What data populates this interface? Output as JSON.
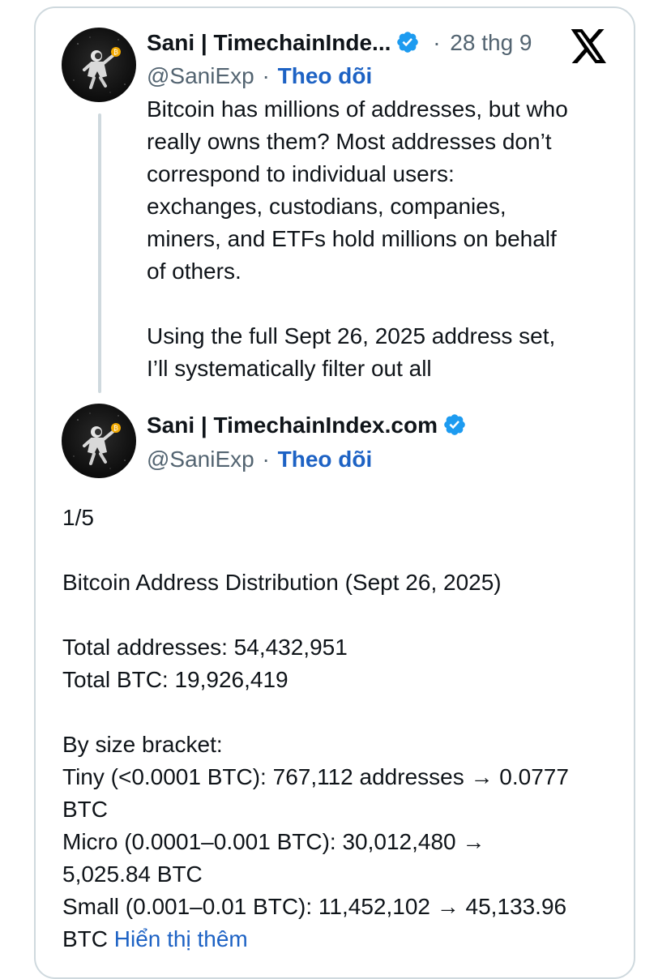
{
  "tweet1": {
    "author_name": "Sani | TimechainInde...",
    "handle": "@SaniExp",
    "separator": "·",
    "follow_label": "Theo dõi",
    "date_separator": "·",
    "date": "28 thg 9",
    "text_lines": [
      "Bitcoin has millions of addresses, but who",
      "really owns them? Most addresses don’t",
      "correspond to individual users:",
      "exchanges, custodians, companies,",
      "miners, and ETFs hold millions on behalf",
      "of others."
    ],
    "text_lines_2": [
      "Using the full Sept 26, 2025 address set,",
      "I’ll systematically filter out all"
    ]
  },
  "tweet2": {
    "author_name": "Sani | TimechainIndex.com",
    "handle": "@SaniExp",
    "separator": "·",
    "follow_label": "Theo dõi",
    "counter": "1/5",
    "title": "Bitcoin Address Distribution (Sept 26, 2025)",
    "total_addresses": "Total addresses: 54,432,951",
    "total_btc": "Total BTC: 19,926,419",
    "bracket_heading": "By size bracket:",
    "bracket_lines": [
      "Tiny (<0.0001 BTC): 767,112 addresses → 0.0777",
      "BTC",
      "Micro (0.0001–0.001 BTC): 30,012,480 →",
      "5,025.84 BTC",
      "Small (0.001–0.01 BTC): 11,452,102 → 45,133.96"
    ],
    "last_line_prefix": "BTC",
    "show_more": "Hiển thị thêm"
  },
  "icons": {
    "verified": "verified-badge-icon",
    "x_logo": "x-logo-icon",
    "avatar": "astronaut-avatar"
  },
  "colors": {
    "verified_blue": "#1d9bf0",
    "link_blue": "#1d62c4",
    "muted": "#536471",
    "border": "#cfd9de"
  }
}
